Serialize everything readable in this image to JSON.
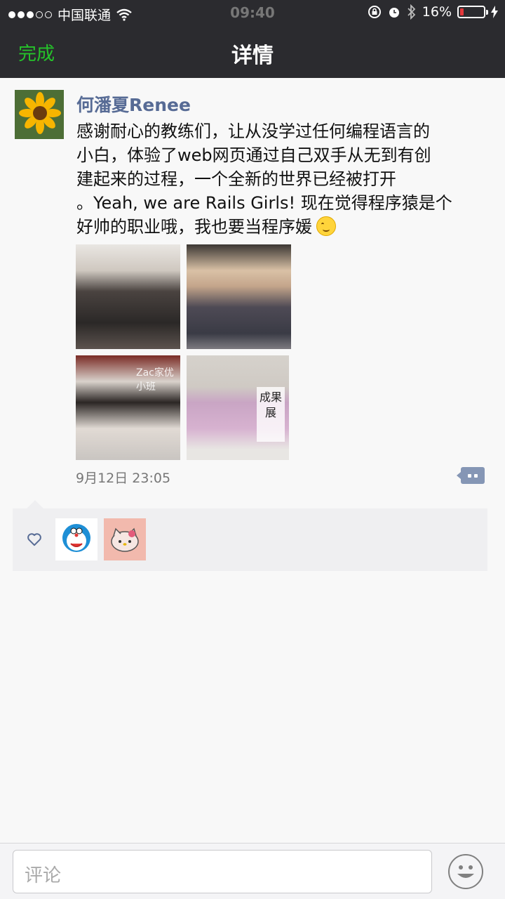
{
  "status_bar": {
    "carrier": "中国联通",
    "time": "09:40",
    "battery": "16%",
    "battery_level": 0.16
  },
  "nav": {
    "done_label": "完成",
    "title": "详情"
  },
  "post": {
    "author": "何潘夏Renee",
    "text_line1": "感谢耐心的教练们，让从没学过任何编程语言的",
    "text_line2": "小白，体验了web网页通过自己双手从无到有创",
    "text_line3": "建起来的过程，一个全新的世界已经被打开",
    "text_line4": "。Yeah, we are Rails Girls! 现在觉得程序猿是个",
    "text_line5": "好帅的职业哦，我也要当程序媛",
    "photo3_caption": "Zac家优小班",
    "photo4_sign": "成果展",
    "timestamp": "9月12日 23:05"
  },
  "likes": {
    "icon": "heart-outline-icon",
    "users": [
      "doraemon-avatar",
      "hello-kitty-avatar"
    ]
  },
  "composer": {
    "placeholder": "评论",
    "emoji_icon": "smiley-icon"
  },
  "colors": {
    "nav_bg": "#2b2b2f",
    "accent_green": "#25c32a",
    "link_blue": "#576b95",
    "comment_btn": "#8596b5"
  }
}
